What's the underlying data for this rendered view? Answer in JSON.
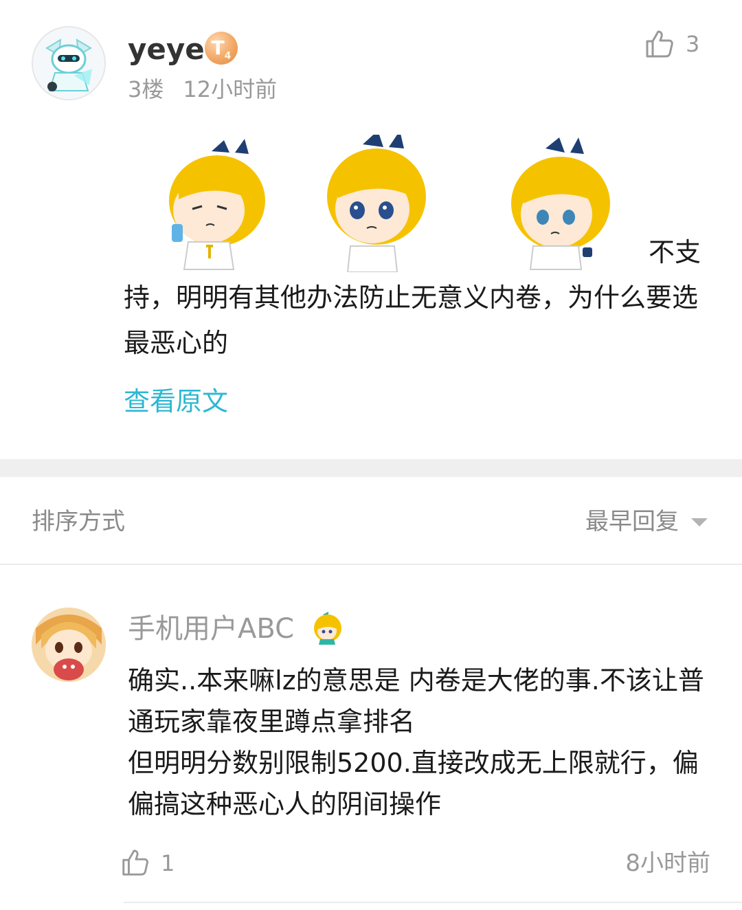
{
  "post": {
    "username": "yeye",
    "level_badge": "T",
    "level_sub": "4",
    "floor": "3楼",
    "time": "12小时前",
    "like_count": "3",
    "text_tail": "不支",
    "text_body": "持，明明有其他办法防止无意义内卷，为什么要选最恶心的",
    "view_original": "查看原文"
  },
  "sort": {
    "label": "排序方式",
    "value": "最早回复"
  },
  "reply": {
    "username": "手机用户ABC",
    "text": "确实..本来嘛lz的意思是  内卷是大佬的事.不该让普通玩家靠夜里蹲点拿排名\n但明明分数别限制5200.直接改成无上限就行，偏偏搞这种恶心人的阴间操作",
    "like_count": "1",
    "time": "8小时前"
  },
  "colors": {
    "link": "#2db7d2",
    "muted": "#999999",
    "divider": "#efefef"
  }
}
